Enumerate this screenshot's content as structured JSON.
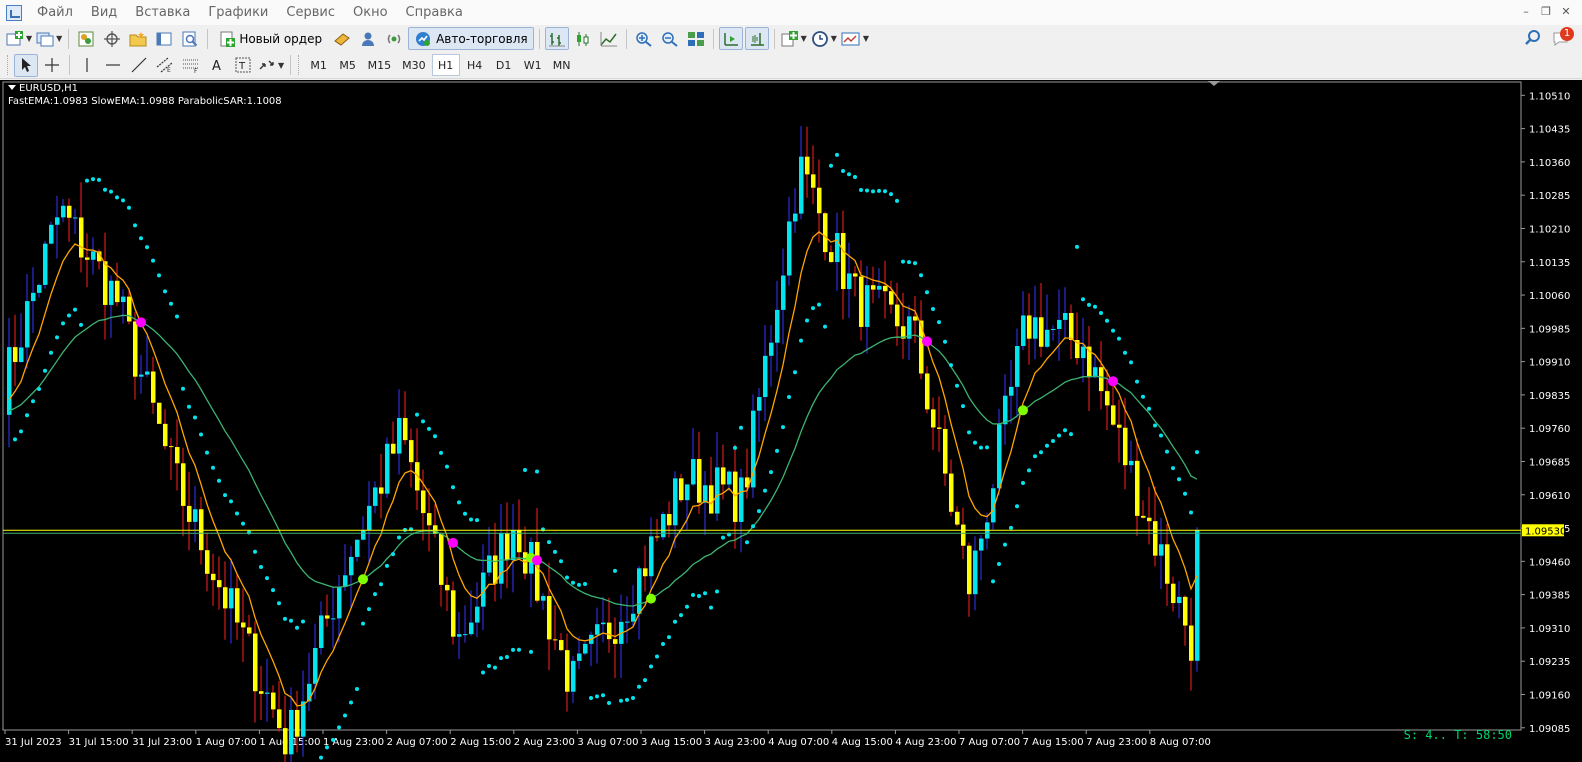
{
  "menu": {
    "items": [
      "Файл",
      "Вид",
      "Вставка",
      "Графики",
      "Сервис",
      "Окно",
      "Справка"
    ]
  },
  "toolbar": {
    "new_order_label": "Новый ордер",
    "auto_trading_label": "Авто-торговля",
    "notification_count": "1"
  },
  "timeframes": [
    "M1",
    "M5",
    "M15",
    "M30",
    "H1",
    "H4",
    "D1",
    "W1",
    "MN"
  ],
  "active_timeframe": "H1",
  "chart": {
    "symbol_title": "EURUSD,H1",
    "indicators_text": "FastEMA:1.0983  SlowEMA:1.0988  ParabolicSAR:1.1008",
    "timer_text": "S: 4..  T: 58:50",
    "current_price": "1.09530"
  },
  "chart_data": {
    "type": "candlestick",
    "symbol": "EURUSD",
    "timeframe": "H1",
    "y_ticks": [
      "1.10510",
      "1.10435",
      "1.10360",
      "1.10285",
      "1.10210",
      "1.10135",
      "1.10060",
      "1.09985",
      "1.09910",
      "1.09835",
      "1.09760",
      "1.09685",
      "1.09610",
      "1.09535",
      "1.09460",
      "1.09385",
      "1.09310",
      "1.09235",
      "1.09160",
      "1.09085"
    ],
    "ylim": [
      1.0908,
      1.1054
    ],
    "x_ticks": [
      "31 Jul 2023",
      "31 Jul 15:00",
      "31 Jul 23:00",
      "1 Aug 07:00",
      "1 Aug 15:00",
      "1 Aug 23:00",
      "2 Aug 07:00",
      "2 Aug 15:00",
      "2 Aug 23:00",
      "3 Aug 07:00",
      "3 Aug 15:00",
      "3 Aug 23:00",
      "4 Aug 07:00",
      "4 Aug 15:00",
      "4 Aug 23:00",
      "7 Aug 07:00",
      "7 Aug 15:00",
      "7 Aug 23:00",
      "8 Aug 07:00"
    ],
    "current_price": 1.0953,
    "close_path": [
      1.0985,
      1.1025,
      1.1005,
      1.0965,
      1.0935,
      1.0905,
      1.0945,
      1.0975,
      1.0928,
      1.0955,
      1.0918,
      1.0938,
      1.0965,
      1.096,
      1.1035,
      1.1005,
      1.0998,
      1.094,
      1.1,
      1.0995,
      1.096,
      1.0925
    ],
    "series": [
      {
        "name": "FastEMA",
        "color": "#ffa500",
        "last_value": 1.0983
      },
      {
        "name": "SlowEMA",
        "color": "#3cb371",
        "last_value": 1.0988
      },
      {
        "name": "ParabolicSAR",
        "color": "#00e5ee",
        "last_value": 1.1008
      }
    ],
    "colors": {
      "bull_body": "#00e5ee",
      "bear_body": "#ffff00",
      "bull_wick": "#3333ff",
      "bear_wick": "#ff2020",
      "price_line": "#ffff00",
      "signal_buy": "#7fff00",
      "signal_sell": "#ff00ff"
    }
  }
}
